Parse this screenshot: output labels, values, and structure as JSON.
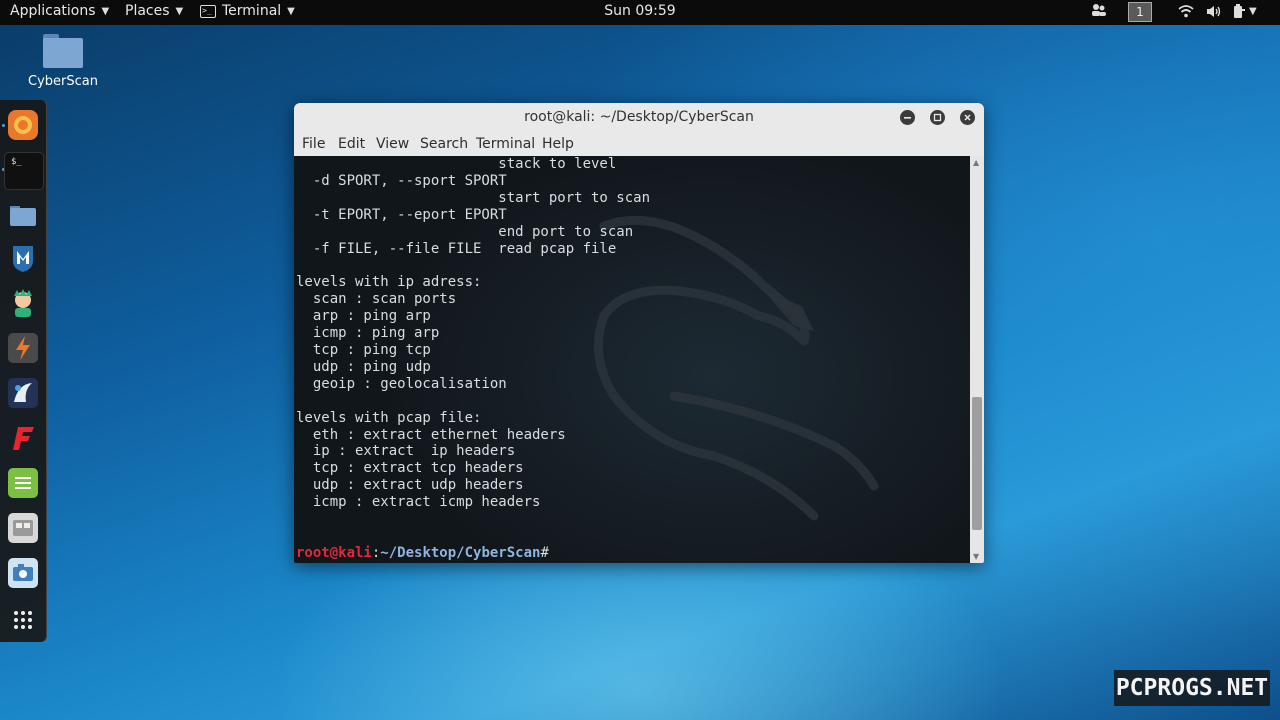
{
  "topbar": {
    "applications_label": "Applications",
    "places_label": "Places",
    "terminal_label": "Terminal",
    "clock": "Sun 09:59",
    "workspace_number": "1"
  },
  "desktop": {
    "folder_label": "CyberScan"
  },
  "dock": {
    "items": [
      "firefox-icon",
      "terminal-icon",
      "files-icon",
      "metasploit-icon",
      "armitage-icon",
      "burpsuite-icon",
      "maltego-icon",
      "faraday-icon",
      "leafpad-icon",
      "cutycapt-icon",
      "screenshot-icon",
      "show-apps-icon"
    ]
  },
  "window": {
    "title": "root@kali: ~/Desktop/CyberScan",
    "menu": [
      "File",
      "Edit",
      "View",
      "Search",
      "Terminal",
      "Help"
    ],
    "terminal_lines": [
      "                        stack to level",
      "  -d SPORT, --sport SPORT",
      "                        start port to scan",
      "  -t EPORT, --eport EPORT",
      "                        end port to scan",
      "  -f FILE, --file FILE  read pcap file",
      "",
      "levels with ip adress:",
      "  scan : scan ports",
      "  arp : ping arp",
      "  icmp : ping arp",
      "  tcp : ping tcp",
      "  udp : ping udp",
      "  geoip : geolocalisation",
      "",
      "levels with pcap file:",
      "  eth : extract ethernet headers",
      "  ip : extract  ip headers",
      "  tcp : extract tcp headers",
      "  udp : extract udp headers",
      "  icmp : extract icmp headers"
    ],
    "prompt_user": "root@kali",
    "prompt_sep": ":",
    "prompt_path": "~/Desktop/CyberScan",
    "prompt_symbol": "#",
    "scroll_position": 0.9
  },
  "watermark": "PCPROGS.NET",
  "colors": {
    "prompt_user": "#e0293a",
    "prompt_path": "#8fb4de",
    "terminal_bg": "#11161b",
    "accent": "#4aa3e0"
  }
}
